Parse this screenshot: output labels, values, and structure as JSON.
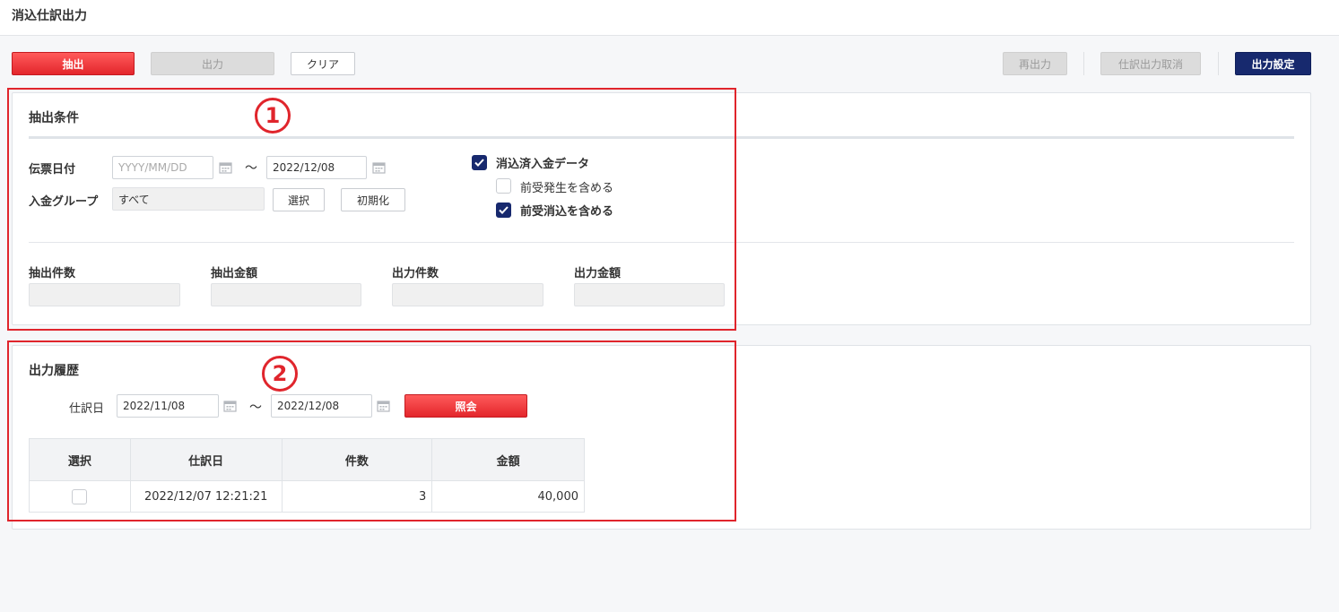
{
  "page": {
    "title": "消込仕訳出力"
  },
  "toolbar": {
    "extract": "抽出",
    "output": "出力",
    "clear": "クリア",
    "reoutput": "再出力",
    "cancel_output": "仕訳出力取消",
    "output_settings": "出力設定"
  },
  "conditions": {
    "title": "抽出条件",
    "marker": "1",
    "slip_date_label": "伝票日付",
    "slip_date_from_placeholder": "YYYY/MM/DD",
    "slip_date_from": "",
    "tilde": "～",
    "slip_date_to": "2022/12/08",
    "deposit_group_label": "入金グループ",
    "deposit_group_value": "すべて",
    "select_button": "選択",
    "reset_button": "初期化",
    "checkboxes": [
      {
        "label": "消込済入金データ",
        "checked": true
      },
      {
        "label": "前受発生を含める",
        "checked": false
      },
      {
        "label": "前受消込を含める",
        "checked": true
      }
    ],
    "summary": {
      "extract_count_label": "抽出件数",
      "extract_amount_label": "抽出金額",
      "output_count_label": "出力件数",
      "output_amount_label": "出力金額",
      "extract_count": "",
      "extract_amount": "",
      "output_count": "",
      "output_amount": ""
    }
  },
  "history": {
    "title": "出力履歴",
    "marker": "2",
    "journal_date_label": "仕訳日",
    "date_from": "2022/11/08",
    "tilde": "～",
    "date_to": "2022/12/08",
    "inquiry_button": "照会",
    "table": {
      "headers": [
        "選択",
        "仕訳日",
        "件数",
        "金額"
      ],
      "rows": [
        {
          "selected": false,
          "journal_date": "2022/12/07 12:21:21",
          "count": "3",
          "amount": "40,000"
        }
      ]
    }
  },
  "colors": {
    "primary_red": "#e3262c",
    "navy": "#17296e",
    "highlight_red": "#e0252c"
  }
}
